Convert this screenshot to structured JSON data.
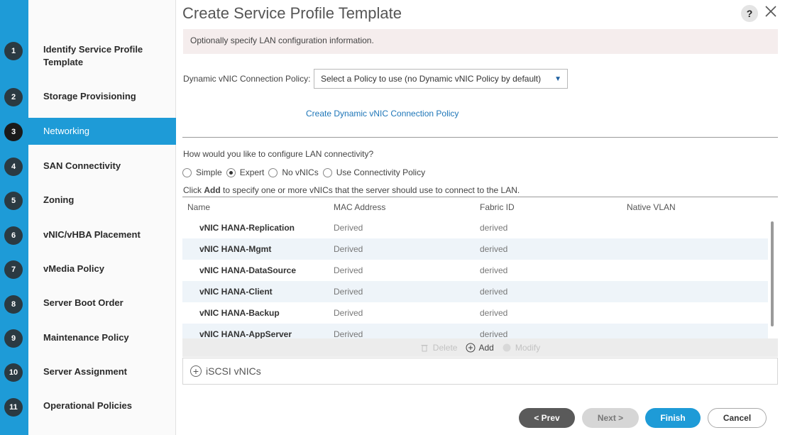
{
  "dialog": {
    "title": "Create Service Profile Template",
    "help_label": "?",
    "info_text": "Optionally specify LAN configuration information."
  },
  "steps": [
    {
      "num": "1",
      "label": "Identify Service Profile Template"
    },
    {
      "num": "2",
      "label": "Storage Provisioning"
    },
    {
      "num": "3",
      "label": "Networking"
    },
    {
      "num": "4",
      "label": "SAN Connectivity"
    },
    {
      "num": "5",
      "label": "Zoning"
    },
    {
      "num": "6",
      "label": "vNIC/vHBA Placement"
    },
    {
      "num": "7",
      "label": "vMedia Policy"
    },
    {
      "num": "8",
      "label": "Server Boot Order"
    },
    {
      "num": "9",
      "label": "Maintenance Policy"
    },
    {
      "num": "10",
      "label": "Server Assignment"
    },
    {
      "num": "11",
      "label": "Operational Policies"
    }
  ],
  "active_step": "Networking",
  "dynamic_vnic": {
    "label": "Dynamic vNIC Connection Policy:",
    "selected": "Select a Policy to use (no Dynamic vNIC Policy by default)",
    "create_link": "Create Dynamic vNIC Connection Policy"
  },
  "lan": {
    "question": "How would you like to configure LAN connectivity?",
    "options": [
      "Simple",
      "Expert",
      "No vNICs",
      "Use Connectivity Policy"
    ],
    "selected": "Expert",
    "hint_prefix": "Click ",
    "hint_bold": "Add",
    "hint_suffix": " to specify one or more vNICs that the server should use to connect to the LAN."
  },
  "table": {
    "columns": [
      "Name",
      "MAC Address",
      "Fabric ID",
      "Native VLAN"
    ],
    "rows": [
      {
        "name": "vNIC HANA-Replication",
        "mac": "Derived",
        "fabric": "derived",
        "vlan": ""
      },
      {
        "name": "vNIC HANA-Mgmt",
        "mac": "Derived",
        "fabric": "derived",
        "vlan": ""
      },
      {
        "name": "vNIC HANA-DataSource",
        "mac": "Derived",
        "fabric": "derived",
        "vlan": ""
      },
      {
        "name": "vNIC HANA-Client",
        "mac": "Derived",
        "fabric": "derived",
        "vlan": ""
      },
      {
        "name": "vNIC HANA-Backup",
        "mac": "Derived",
        "fabric": "derived",
        "vlan": ""
      },
      {
        "name": "vNIC HANA-AppServer",
        "mac": "Derived",
        "fabric": "derived",
        "vlan": ""
      }
    ],
    "actions": {
      "delete": "Delete",
      "add": "Add",
      "modify": "Modify"
    }
  },
  "iscsi": {
    "label": "iSCSI vNICs"
  },
  "footer": {
    "prev": "< Prev",
    "next": "Next >",
    "finish": "Finish",
    "cancel": "Cancel"
  },
  "colors": {
    "accent": "#1e9bd7",
    "step_circle": "#2b3a42",
    "link": "#1e76b8"
  }
}
